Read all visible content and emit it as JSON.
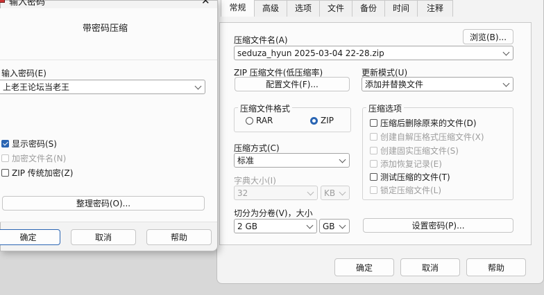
{
  "password_dialog": {
    "title": "输入密码",
    "heading": "带密码压缩",
    "password_label": "输入密码(E)",
    "password_value": "上老王论坛当老王",
    "options": [
      {
        "label": "显示密码(S)",
        "checked": true,
        "disabled": false
      },
      {
        "label": "加密文件名(N)",
        "checked": false,
        "disabled": true
      },
      {
        "label": "ZIP 传统加密(Z)",
        "checked": false,
        "disabled": false
      }
    ],
    "organize_button": "整理密码(O)...",
    "ok_button": "确定",
    "cancel_button": "取消",
    "help_button": "帮助"
  },
  "archive_dialog": {
    "tabs": [
      "常规",
      "高级",
      "选项",
      "文件",
      "备份",
      "时间",
      "注释"
    ],
    "active_tab": "常规",
    "archive_name_label": "压缩文件名(A)",
    "browse_button": "浏览(B)...",
    "archive_name_value": "seduza_hyun 2025-03-04 22-28.zip",
    "zip_profile_label": "ZIP 压缩文件(低压缩率)",
    "configure_button": "配置文件(F)...",
    "update_mode_label": "更新模式(U)",
    "update_mode_value": "添加并替换文件",
    "format_group_title": "压缩文件格式",
    "format_rar": "RAR",
    "format_zip": "ZIP",
    "selected_format": "ZIP",
    "options_group_title": "压缩选项",
    "options": [
      {
        "label": "压缩后删除原来的文件(D)",
        "checked": false,
        "disabled": false
      },
      {
        "label": "创建自解压格式压缩文件(X)",
        "checked": false,
        "disabled": true
      },
      {
        "label": "创建固实压缩文件(S)",
        "checked": false,
        "disabled": true
      },
      {
        "label": "添加恢复记录(E)",
        "checked": false,
        "disabled": true
      },
      {
        "label": "测试压缩的文件(T)",
        "checked": false,
        "disabled": false
      },
      {
        "label": "锁定压缩文件(L)",
        "checked": false,
        "disabled": true
      }
    ],
    "method_label": "压缩方式(C)",
    "method_value": "标准",
    "dict_label": "字典大小(I)",
    "dict_value": "32",
    "dict_unit": "KB",
    "split_label": "切分为分卷(V)，大小",
    "split_value": "2 GB",
    "split_unit": "GB",
    "set_password_button": "设置密码(P)...",
    "ok_button": "确定",
    "cancel_button": "取消",
    "help_button": "帮助"
  },
  "colors": {
    "accent": "#2a65b3",
    "dialog_bg": "#f3f3f3",
    "panel_bg": "#fbfbfb"
  }
}
